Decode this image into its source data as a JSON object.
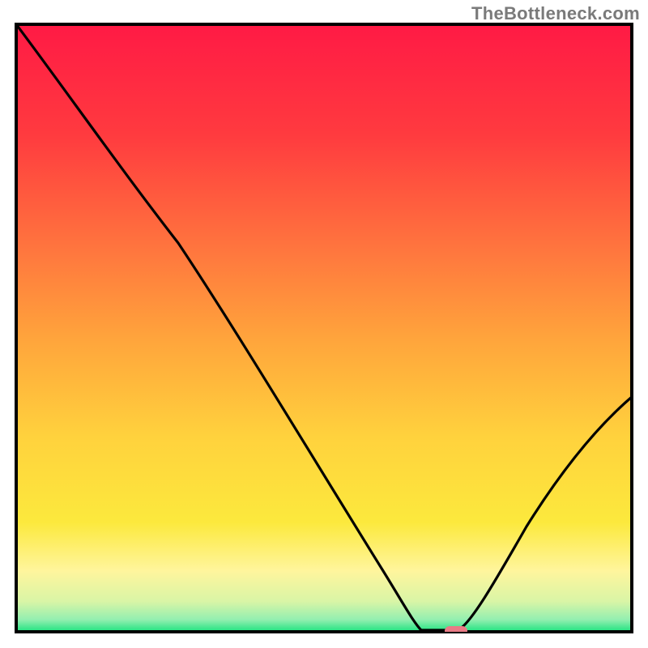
{
  "watermark": "TheBottleneck.com",
  "chart_data": {
    "type": "line",
    "title": "",
    "xlabel": "",
    "ylabel": "",
    "xlim": [
      0,
      100
    ],
    "ylim": [
      0,
      100
    ],
    "grid": false,
    "legend": null,
    "x": [
      0,
      26,
      65,
      70,
      73,
      100
    ],
    "values": [
      100,
      66,
      0,
      0,
      1,
      38
    ],
    "gradient_colors": {
      "top": "#ff1a45",
      "upper_mid": "#ff8a3e",
      "mid": "#ffd23d",
      "lower_mid": "#fff59d",
      "bottom": "#1de27f"
    },
    "marker": {
      "x": 71.5,
      "y": 0,
      "color": "#e97b86",
      "shape": "rounded-pill"
    },
    "notes": "x is % of chart width; values are % of chart height. Curve is an asymmetric V dipping to 0 near x≈65–73, with a flat trough; left descent steeper near top then roughly linear; right ascent slightly concave, ending near y≈38 at x=100."
  }
}
